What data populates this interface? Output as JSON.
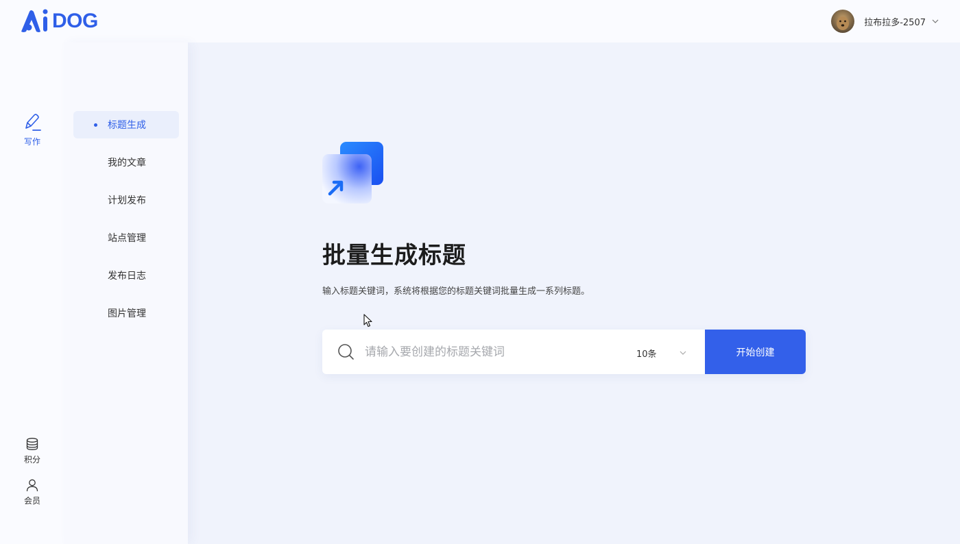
{
  "brand": {
    "logo_text": "DOG",
    "logo_mark": "A",
    "accent": "#2f5fe8"
  },
  "user": {
    "name": "拉布拉多-2507"
  },
  "rail": {
    "write": {
      "label": "写作",
      "icon": "pen-icon"
    },
    "points": {
      "label": "积分",
      "icon": "database-icon"
    },
    "member": {
      "label": "会员",
      "icon": "user-icon"
    }
  },
  "sidebar": {
    "items": [
      {
        "label": "标题生成",
        "active": true
      },
      {
        "label": "我的文章"
      },
      {
        "label": "计划发布"
      },
      {
        "label": "站点管理"
      },
      {
        "label": "发布日志"
      },
      {
        "label": "图片管理"
      }
    ]
  },
  "main": {
    "title": "批量生成标题",
    "description": "输入标题关键词，系统将根据您的标题关键词批量生成一系列标题。",
    "search": {
      "placeholder": "请输入要创建的标题关键词",
      "value": ""
    },
    "count_select": {
      "selected": "10条"
    },
    "create_button": "开始创建"
  }
}
